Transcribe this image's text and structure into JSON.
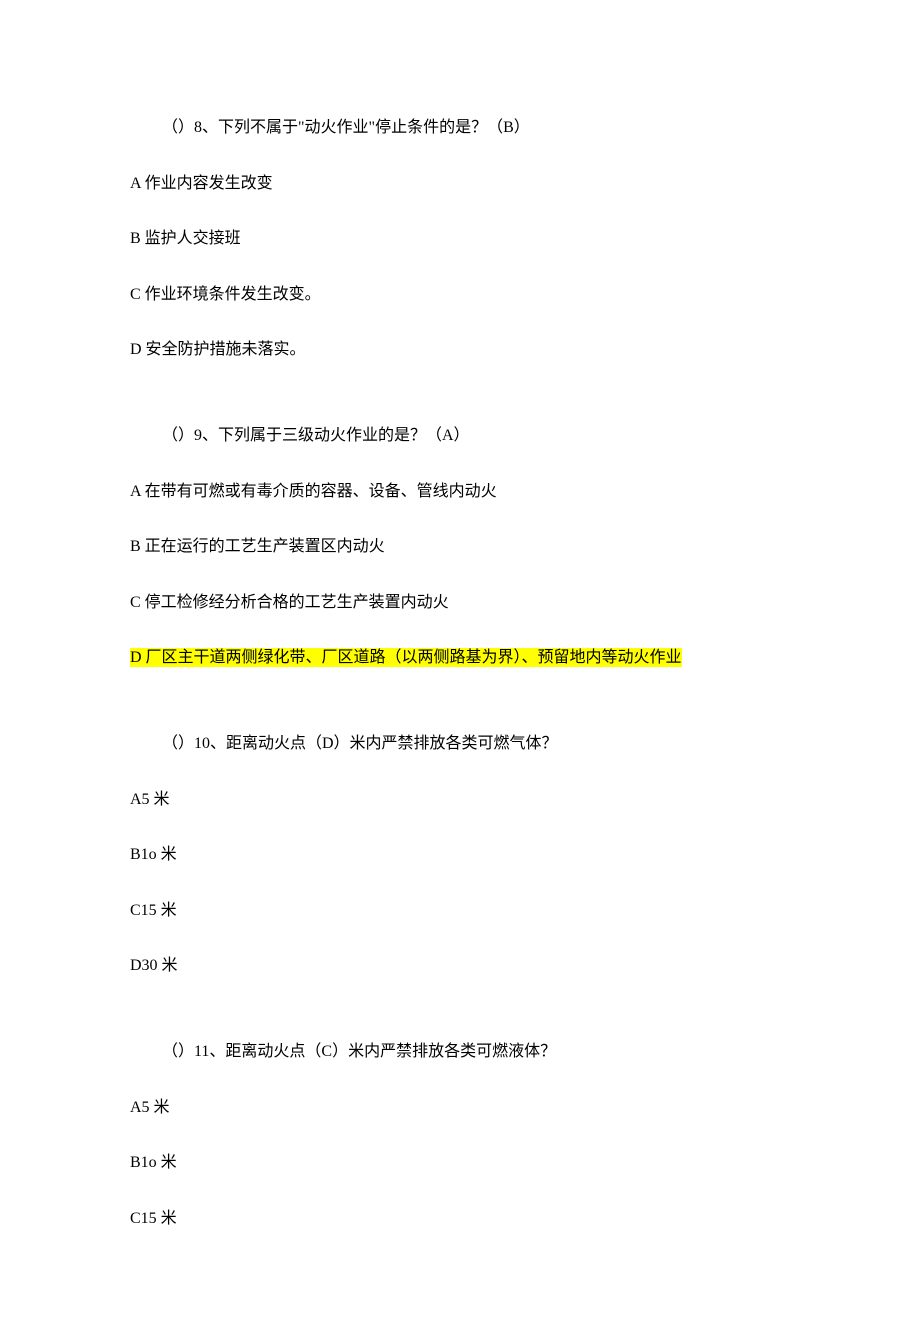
{
  "q8": {
    "stem": "（）8、下列不属于\"动火作业\"停止条件的是？（B）",
    "a": "A 作业内容发生改变",
    "b": "B 监护人交接班",
    "c": "C 作业环境条件发生改变。",
    "d": "D 安全防护措施未落实。"
  },
  "q9": {
    "stem": "（）9、下列属于三级动火作业的是？（A）",
    "a": "A 在带有可燃或有毒介质的容器、设备、管线内动火",
    "b": "B 正在运行的工艺生产装置区内动火",
    "c": "C 停工检修经分析合格的工艺生产装置内动火",
    "d": "D 厂区主干道两侧绿化带、厂区道路（以两侧路基为界）、预留地内等动火作业"
  },
  "q10": {
    "stem": "（）10、距离动火点（D）米内严禁排放各类可燃气体？",
    "a": "A5 米",
    "b": "B1o 米",
    "c": "C15 米",
    "d": "D30 米"
  },
  "q11": {
    "stem": "（）11、距离动火点（C）米内严禁排放各类可燃液体？",
    "a": "A5 米",
    "b": "B1o 米",
    "c": "C15 米"
  }
}
